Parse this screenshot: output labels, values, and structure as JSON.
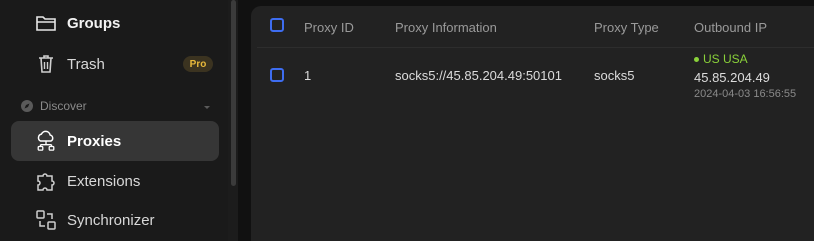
{
  "sidebar": {
    "items": [
      {
        "label": "Groups",
        "icon": "folder-icon"
      },
      {
        "label": "Trash",
        "icon": "trash-icon",
        "badge": "Pro"
      },
      {
        "label": "Proxies",
        "icon": "proxy-network-icon",
        "active": true
      },
      {
        "label": "Extensions",
        "icon": "puzzle-icon"
      },
      {
        "label": "Synchronizer",
        "icon": "synchronizer-icon"
      }
    ],
    "section": {
      "label": "Discover",
      "icon": "compass-icon"
    }
  },
  "table": {
    "columns": [
      "Proxy ID",
      "Proxy Information",
      "Proxy Type",
      "Outbound IP"
    ],
    "rows": [
      {
        "id": "1",
        "info": "socks5://45.85.204.49:50101",
        "type": "socks5",
        "outbound": {
          "country": "US USA",
          "ip": "45.85.204.49",
          "time": "2024-04-03 16:56:55"
        }
      }
    ]
  },
  "colors": {
    "accent": "#3e6df0",
    "status_green": "#8ad23a",
    "pro_badge": "#e8b93b"
  }
}
